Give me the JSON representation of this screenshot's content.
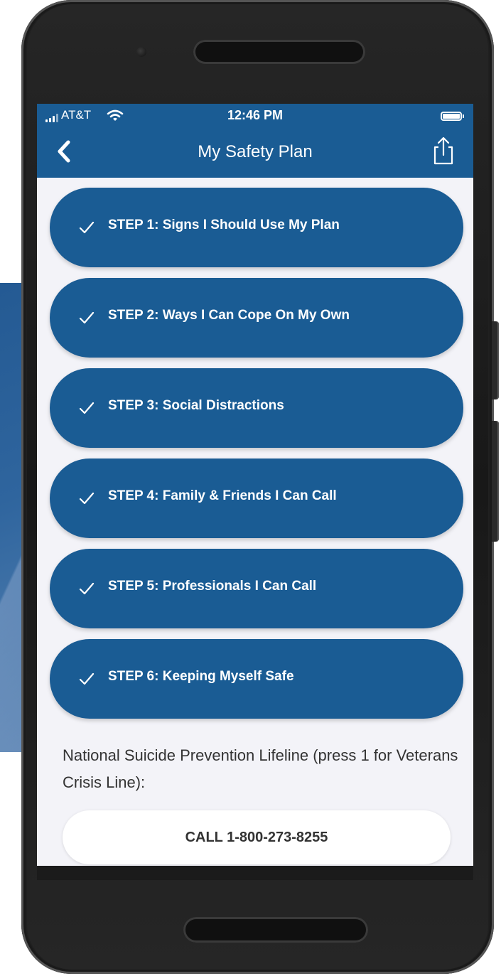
{
  "status_bar": {
    "carrier": "AT&T",
    "time": "12:46 PM"
  },
  "nav": {
    "title": "My Safety Plan"
  },
  "steps": [
    {
      "label": "STEP 1: Signs I Should Use My Plan",
      "completed": true
    },
    {
      "label": "STEP 2: Ways I Can Cope On My Own",
      "completed": true
    },
    {
      "label": "STEP 3: Social Distractions",
      "completed": true
    },
    {
      "label": "STEP 4: Family & Friends I Can Call",
      "completed": true
    },
    {
      "label": "STEP 5: Professionals I Can Call",
      "completed": true
    },
    {
      "label": "STEP 6: Keeping Myself Safe",
      "completed": true
    }
  ],
  "lifeline": {
    "text": "National Suicide Prevention Lifeline (press 1 for Veterans Crisis Line):",
    "call_label": "CALL 1-800-273-8255"
  },
  "icons": {
    "back": "chevron-left-icon",
    "share": "share-icon",
    "check": "checkmark-icon",
    "wifi": "wifi-icon",
    "signal": "signal-icon",
    "battery": "battery-icon"
  },
  "colors": {
    "primary": "#1a5c94",
    "screen_background": "#f3f3f8",
    "call_button": "#ffffff"
  }
}
